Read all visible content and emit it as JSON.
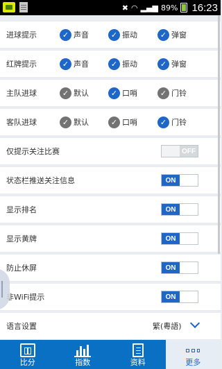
{
  "status_bar": {
    "time": "16:23",
    "battery": "89%"
  },
  "settings": {
    "goal_alert": {
      "label": "进球提示",
      "options": [
        {
          "label": "声音",
          "checked": true
        },
        {
          "label": "振动",
          "checked": true
        },
        {
          "label": "弹窗",
          "checked": true
        }
      ]
    },
    "red_card_alert": {
      "label": "红牌提示",
      "options": [
        {
          "label": "声音",
          "checked": true
        },
        {
          "label": "振动",
          "checked": true
        },
        {
          "label": "弹窗",
          "checked": true
        }
      ]
    },
    "home_goal": {
      "label": "主队进球",
      "options": [
        {
          "label": "默认",
          "checked": false
        },
        {
          "label": "口哨",
          "checked": true
        },
        {
          "label": "门铃",
          "checked": false
        }
      ]
    },
    "away_goal": {
      "label": "客队进球",
      "options": [
        {
          "label": "默认",
          "checked": false
        },
        {
          "label": "口哨",
          "checked": false
        },
        {
          "label": "门铃",
          "checked": true
        }
      ]
    },
    "followed_only": {
      "label": "仅提示关注比赛",
      "state": "OFF"
    },
    "statusbar_push": {
      "label": "状态栏推送关注信息",
      "state": "ON"
    },
    "show_rank": {
      "label": "显示排名",
      "state": "ON"
    },
    "show_yellow": {
      "label": "显示黄牌",
      "state": "ON"
    },
    "prevent_sleep": {
      "label": "防止休屏",
      "state": "ON"
    },
    "wifi_alert": {
      "label": "非WiFi提示",
      "state": "ON"
    },
    "language": {
      "label": "语言设置",
      "value": "繁(粵語)"
    }
  },
  "tabs": [
    {
      "label": "比分",
      "icon": "scoreboard-icon",
      "active": false
    },
    {
      "label": "指数",
      "icon": "bar-chart-icon",
      "active": false
    },
    {
      "label": "资料",
      "icon": "document-icon",
      "active": false
    },
    {
      "label": "更多",
      "icon": "more-icon",
      "active": true
    }
  ],
  "colors": {
    "accent": "#1f66c9",
    "tabbar": "#0a70c4",
    "unchecked": "#737373"
  }
}
